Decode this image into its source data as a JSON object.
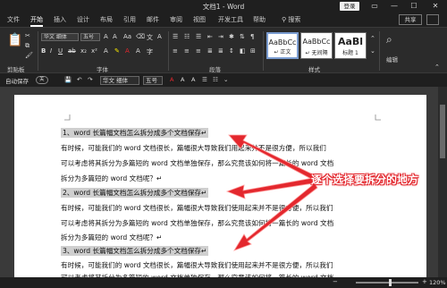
{
  "titlebar": {
    "title": "文档1  -  Word",
    "login": "登录",
    "min": "—",
    "max": "☐",
    "close": "✕"
  },
  "tabs": [
    "文件",
    "开始",
    "插入",
    "设计",
    "布局",
    "引用",
    "邮件",
    "审阅",
    "视图",
    "开发工具",
    "帮助"
  ],
  "active_tab": "开始",
  "search": "搜索",
  "share": "共享",
  "ribbon": {
    "clipboard_label": "剪贴板",
    "font_label": "字体",
    "paragraph_label": "段落",
    "styles_label": "样式",
    "font_name": "华文 细体",
    "font_size": "五号",
    "styles": [
      {
        "sample": "AaBbCc",
        "name": "↵ 正文"
      },
      {
        "sample": "AaBbCc",
        "name": "↵ 无间隔"
      },
      {
        "sample": "AaBl",
        "name": "标题 1"
      }
    ],
    "editing": "编辑"
  },
  "qat": {
    "autosave": "自动保存",
    "autosave_state": "关",
    "font_name": "华文 细体",
    "font_size": "五号"
  },
  "document": {
    "lines": [
      {
        "text": "1、word 长篇幅文档怎么拆分成多个文档保存↵",
        "heading": true
      },
      {
        "text": "有时候，可能我们的 word 文档很长，篇幅很大导致我们用起来并不是很方便，所以我们",
        "heading": false
      },
      {
        "text": "可以考虑将其拆分为多篇短的 word 文档单独保存，那么究竟该如何将一篇长的 word 文档",
        "heading": false
      },
      {
        "text": "拆分为多篇短的 word 文档呢？↵",
        "heading": false
      },
      {
        "text": "2、word 长篇幅文档怎么拆分成多个文档保存↵",
        "heading": true
      },
      {
        "text": "有时候，可能我们的 word 文档很长，篇幅很大导致我们使用起来并不是很方便，所以我们",
        "heading": false
      },
      {
        "text": "可以考虑将其拆分为多篇短的 word 文档单独保存，那么究竟该如何将一篇长的 word 文档",
        "heading": false
      },
      {
        "text": "拆分为多篇短的 word 文档呢？↵",
        "heading": false
      },
      {
        "text": "3、word 长篇幅文档怎么拆分成多个文档保存↵",
        "heading": true
      },
      {
        "text": "有时候，可能我们的 word 文档很长，篇幅很大导致我们使用起来并不是很方便，所以我们",
        "heading": false
      },
      {
        "text": "可以考虑将其拆分为多篇短的 word 文档单独保存，那么究竟该如何将一篇长的 word 文档",
        "heading": false
      }
    ]
  },
  "annotation": "逐个选择要拆分的地方",
  "status": {
    "zoom": "120%"
  },
  "colors": {
    "annotation_red": "#e3282e",
    "ribbon_bg": "#2b2b2b",
    "heading_highlight": "#cfcfcf"
  }
}
